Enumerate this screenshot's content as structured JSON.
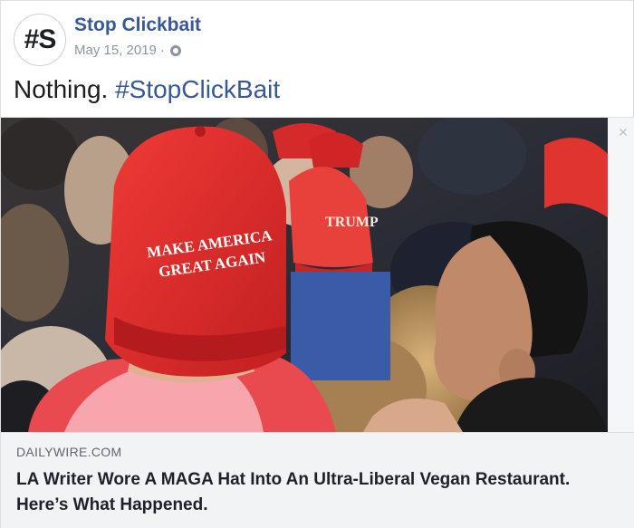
{
  "page": {
    "avatar_text": "#S",
    "name": "Stop Clickbait",
    "date": "May 15, 2019",
    "separator": "·",
    "audience_icon": "globe-icon"
  },
  "post": {
    "text": "Nothing.",
    "hashtag": "#StopClickBait"
  },
  "photo": {
    "hat_text_line1": "MAKE AMERICA",
    "hat_text_line2": "GREAT AGAIN",
    "hat_text_back": "TRUMP"
  },
  "link": {
    "domain": "DAILYWIRE.COM",
    "headline": "LA Writer Wore A MAGA Hat Into An Ultra-Liberal Vegan Restaurant. Here’s What Happened.",
    "hide_icon": "close-icon"
  },
  "colors": {
    "link_blue": "#385898",
    "meta_gray": "#8d949e",
    "caption_bg": "#f2f3f5",
    "hat_red": "#e02a2a"
  }
}
